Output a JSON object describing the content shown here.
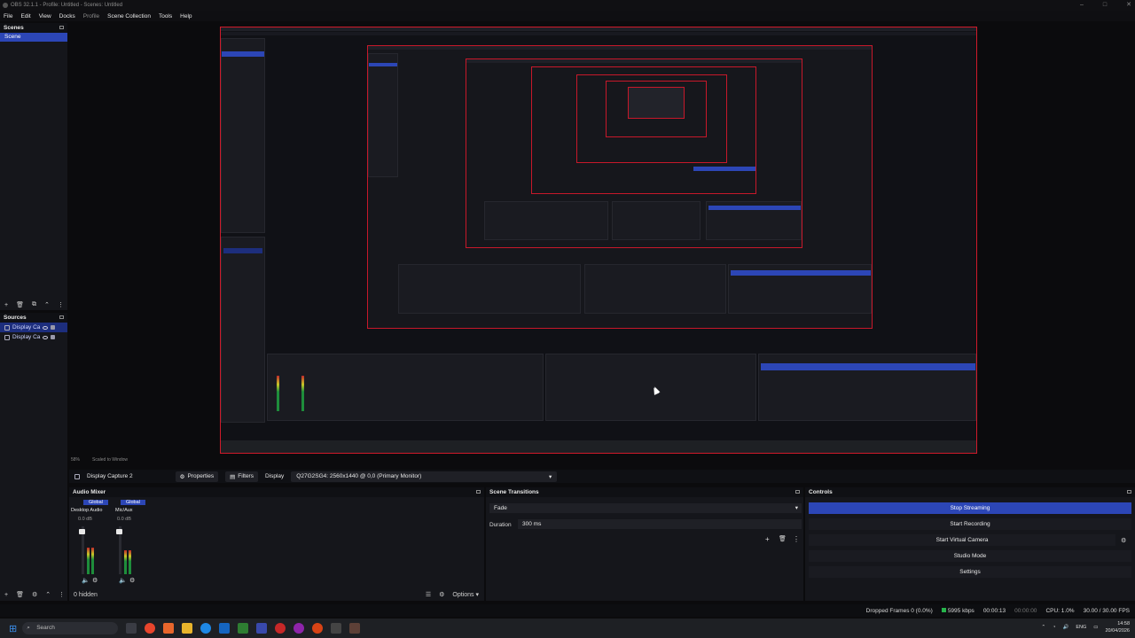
{
  "window": {
    "title": "OBS 32.1.1 - Profile: Untitled - Scenes: Untitled",
    "controls": [
      "–",
      "□",
      "✕"
    ]
  },
  "menu": {
    "items": [
      "File",
      "Edit",
      "View",
      "Docks",
      "Profile",
      "Scene Collection",
      "Tools",
      "Help"
    ]
  },
  "scenes": {
    "title": "Scenes",
    "items": [
      "Scene"
    ],
    "selected": "Scene"
  },
  "sources": {
    "title": "Sources",
    "items": [
      "Display Ca",
      "Display Ca"
    ]
  },
  "preview_strip": {
    "zoom": "58%",
    "label": "Scaled to Window"
  },
  "source_bar": {
    "source_name": "Display Capture 2",
    "properties_label": "Properties",
    "filters_label": "Filters",
    "display_label": "Display",
    "display_value": "Q27G2SG4: 2560x1440 @ 0,0 (Primary Monitor)"
  },
  "audio_mixer": {
    "title": "Audio Mixer",
    "channels": [
      {
        "global": "Global",
        "name": "Desktop Audio",
        "db": "0.0 dB",
        "level": 0.55
      },
      {
        "global": "Global",
        "name": "Mic/Aux",
        "db": "0.0 dB",
        "level": 0.5
      }
    ],
    "hidden_label": "0 hidden",
    "options_label": "Options"
  },
  "transitions": {
    "title": "Scene Transitions",
    "selected": "Fade",
    "duration_label": "Duration",
    "duration_value": "300 ms"
  },
  "controls": {
    "title": "Controls",
    "buttons": [
      "Stop Streaming",
      "Start Recording",
      "Start Virtual Camera",
      "Studio Mode",
      "Settings"
    ]
  },
  "status": {
    "dropped": "Dropped Frames 0 (0.0%)",
    "bitrate": "5995 kbps",
    "stream_time": "00:00:13",
    "rec_time": "00:00:00",
    "cpu": "CPU: 1.0%",
    "fps": "30.00 / 30.00 FPS"
  },
  "taskbar": {
    "search_placeholder": "Search",
    "lang": "ENG",
    "time": "14:58",
    "date": "20/04/2026"
  },
  "colors": {
    "accent": "#2c46b6",
    "preview_border": "#d01a2a",
    "panel": "#15161b",
    "background": "#0b0b0d"
  }
}
